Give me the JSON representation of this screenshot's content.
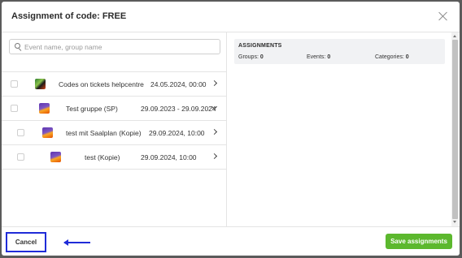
{
  "dialog": {
    "title": "Assignment of code: FREE"
  },
  "search": {
    "placeholder": "Event name, group name",
    "value": ""
  },
  "events": [
    {
      "name": "Codes on tickets helpcentre",
      "date": "24.05.2024, 00:00",
      "expand": "chevron-right",
      "indent": 0
    },
    {
      "name": "Test gruppe (SP)",
      "date": "29.09.2023 - 29.09.2024",
      "expand": "chevron-down",
      "indent": 0
    },
    {
      "name": "test mit Saalplan (Kopie)",
      "date": "29.09.2024, 10:00",
      "expand": "chevron-right",
      "indent": 1
    },
    {
      "name": "test (Kopie)",
      "date": "29.09.2024, 10:00",
      "expand": "chevron-right",
      "indent": 1
    }
  ],
  "assignments": {
    "title": "ASSIGNMENTS",
    "groups_label": "Groups:",
    "groups_count": "0",
    "events_label": "Events:",
    "events_count": "0",
    "categories_label": "Categories:",
    "categories_count": "0"
  },
  "footer": {
    "cancel_label": "Cancel",
    "save_label": "Save assignments"
  },
  "colors": {
    "save_button": "#5cb82e",
    "highlight_annotation": "#1f2bd8"
  }
}
